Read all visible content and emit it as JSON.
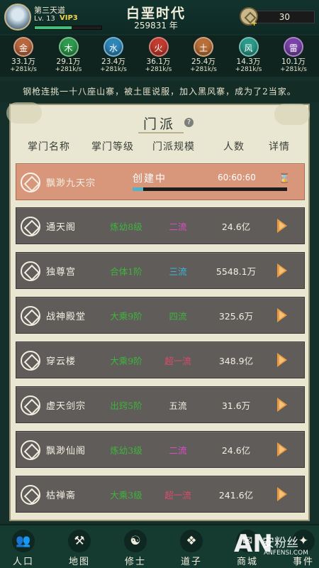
{
  "header": {
    "player_name": "第三天道",
    "level": "Lv. 13",
    "vip": "VIP3",
    "xp_progress": 0.55,
    "era_title": "白垩时代",
    "year": "259831 年",
    "coins": "30"
  },
  "elements": [
    {
      "glyph": "金",
      "value": "33.1万",
      "rate": "+281k/s",
      "color": "#b8683f"
    },
    {
      "glyph": "木",
      "value": "29.1万",
      "rate": "+281k/s",
      "color": "#2f9a4d"
    },
    {
      "glyph": "水",
      "value": "23.4万",
      "rate": "+281k/s",
      "color": "#2e86b8"
    },
    {
      "glyph": "火",
      "value": "36.1万",
      "rate": "+281k/s",
      "color": "#c13b2f"
    },
    {
      "glyph": "土",
      "value": "25.4万",
      "rate": "+281k/s",
      "color": "#b8703a"
    },
    {
      "glyph": "风",
      "value": "14.3万",
      "rate": "+281k/s",
      "color": "#2c9a8a"
    },
    {
      "glyph": "雷",
      "value": "10.1万",
      "rate": "+281k/s",
      "color": "#7a43a8"
    }
  ],
  "ticker": "钢枪连挑一十八座山寨，被土匪说服，加入黑风寨，成为了2当家。",
  "panel": {
    "title": "门派",
    "columns": [
      "掌门名称",
      "掌门等级",
      "门派规模",
      "人数",
      "详情"
    ],
    "building": {
      "name": "飘渺九天宗",
      "status": "创建中",
      "timer": "60:60:60",
      "hourglass": "⌛",
      "progress": 0.07
    },
    "sects": [
      {
        "name": "通天阁",
        "rank": "炼幼8级",
        "rank_color": "#3fb53c",
        "scale": "二流",
        "scale_color": "#e04ac9",
        "pop": "24.6亿"
      },
      {
        "name": "独尊宫",
        "rank": "合体1阶",
        "rank_color": "#3fb53c",
        "scale": "三流",
        "scale_color": "#3ab6d8",
        "pop": "5548.1万"
      },
      {
        "name": "战神殿堂",
        "rank": "大乘9阶",
        "rank_color": "#3fb53c",
        "scale": "四流",
        "scale_color": "#3fb53c",
        "pop": "325.6万"
      },
      {
        "name": "穿云楼",
        "rank": "大乘9阶",
        "rank_color": "#3fb53c",
        "scale": "超一流",
        "scale_color": "#e04a6a",
        "pop": "348.9亿"
      },
      {
        "name": "虚天剑宗",
        "rank": "出窍5阶",
        "rank_color": "#3fb53c",
        "scale": "五流",
        "scale_color": "#f3efe2",
        "pop": "31.6万"
      },
      {
        "name": "飘渺仙阁",
        "rank": "炼幼3级",
        "rank_color": "#3fb53c",
        "scale": "二流",
        "scale_color": "#e04ac9",
        "pop": "24.6亿"
      },
      {
        "name": "枯禅斋",
        "rank": "大乘3级",
        "rank_color": "#3fb53c",
        "scale": "超一流",
        "scale_color": "#e04a6a",
        "pop": "241.6亿"
      }
    ]
  },
  "nav": [
    {
      "label": "人口",
      "glyph": "👥",
      "icon": "population-icon"
    },
    {
      "label": "地图",
      "glyph": "⚒",
      "icon": "map-tools-icon"
    },
    {
      "label": "修士",
      "glyph": "☯",
      "icon": "cultivator-icon"
    },
    {
      "label": "道子",
      "glyph": "❖",
      "icon": "daozi-icon"
    },
    {
      "label": "商城",
      "glyph": "✉",
      "icon": "shop-icon"
    },
    {
      "label": "事件",
      "glyph": "✦",
      "icon": "event-icon"
    }
  ],
  "watermark": {
    "an": "AN",
    "cn": "安粉丝",
    "en": "ANFENSI.COM"
  }
}
